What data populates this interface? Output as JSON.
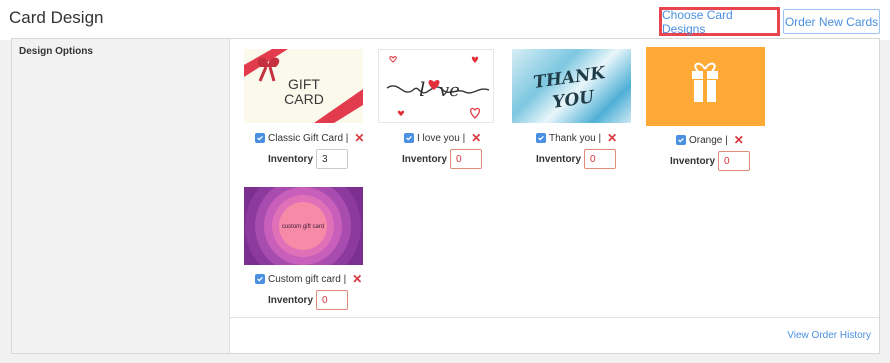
{
  "header": {
    "title": "Card Design",
    "choose_button": "Choose Card Designs",
    "order_button": "Order New Cards"
  },
  "sidebar": {
    "label": "Design Options"
  },
  "inventory_label": "Inventory",
  "cards": [
    {
      "name": "Classic Gift Card |",
      "inventory": "3",
      "checked": true,
      "image_text": "GIFT CARD"
    },
    {
      "name": "I love you |",
      "inventory": "0",
      "checked": true,
      "image_text": "love"
    },
    {
      "name": "Thank you |",
      "inventory": "0",
      "checked": true,
      "image_text": "THANK YOU"
    },
    {
      "name": "Orange |",
      "inventory": "0",
      "checked": true
    },
    {
      "name": "Custom gift card |",
      "inventory": "0",
      "checked": true,
      "image_text": "custom gift card"
    }
  ],
  "footer": {
    "history_link": "View Order History"
  },
  "colors": {
    "accent": "#4a90e2",
    "highlight": "#e8454e",
    "remove": "#d9363e"
  }
}
